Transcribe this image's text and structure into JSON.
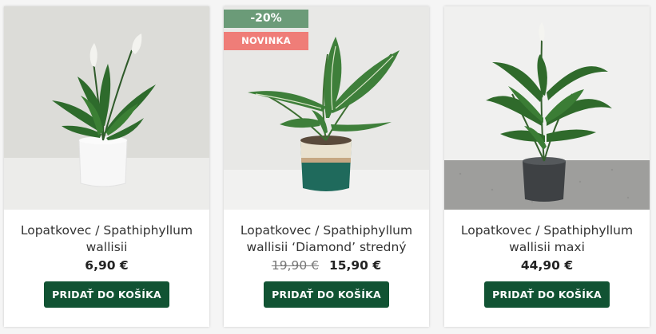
{
  "products": [
    {
      "title": "Lopatkovec / Spathiphyllum wallisii",
      "price": "6,90 €",
      "button_label": "PRIDAŤ DO KOŠÍKA"
    },
    {
      "title": "Lopatkovec / Spathiphyllum wallisii ‘Diamond’ stredný",
      "old_price": "19,90 €",
      "price": "15,90 €",
      "badge_discount": "-20%",
      "badge_new": "NOVINKA",
      "button_label": "PRIDAŤ DO KOŠÍKA"
    },
    {
      "title": "Lopatkovec / Spathiphyllum wallisii maxi",
      "price": "44,90 €",
      "button_label": "PRIDAŤ DO KOŠÍKA"
    }
  ],
  "colors": {
    "button": "#115333",
    "badge_discount": "#6b9b78",
    "badge_new": "#ef7d78"
  }
}
